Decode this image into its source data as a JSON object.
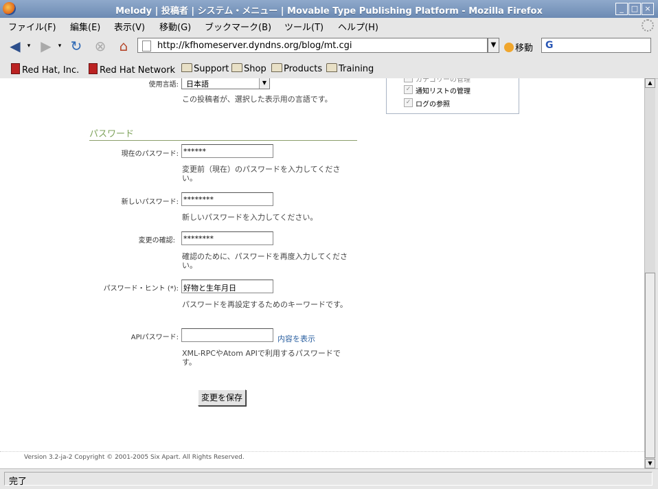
{
  "window": {
    "title": "Melody | 投稿者 | システム・メニュー | Movable Type Publishing Platform - Mozilla Firefox",
    "buttons": [
      "_",
      "□",
      "×"
    ]
  },
  "menu": {
    "items": [
      "ファイル(F)",
      "編集(E)",
      "表示(V)",
      "移動(G)",
      "ブックマーク(B)",
      "ツール(T)",
      "ヘルプ(H)"
    ]
  },
  "nav": {
    "url": "http://kfhomeserver.dyndns.org/blog/mt.cgi",
    "go_label": "移動",
    "search_placeholder": ""
  },
  "bookmarks": [
    "Red Hat, Inc.",
    "Red Hat Network",
    "Support",
    "Shop",
    "Products",
    "Training"
  ],
  "language": {
    "label": "使用言語:",
    "value": "日本語",
    "help": "この投稿者が、選択した表示用の言語です。"
  },
  "permissions": [
    "カテゴリーの管理",
    "通知リストの管理",
    "ログの参照"
  ],
  "password_section": {
    "title": "パスワード",
    "current": {
      "label": "現在のパスワード:",
      "value": "******",
      "help": "変更前（現在）のパスワードを入力してください。"
    },
    "new": {
      "label": "新しいパスワード:",
      "value": "********",
      "help": "新しいパスワードを入力してください。"
    },
    "confirm": {
      "label": "変更の確認:",
      "value": "********",
      "help": "確認のために、パスワードを再度入力してください。"
    },
    "hint": {
      "label": "パスワード・ヒント (*):",
      "value": "好物と生年月日",
      "help": "パスワードを再設定するためのキーワードです。"
    },
    "api": {
      "label": "APIパスワード:",
      "value": "",
      "show_link": "内容を表示",
      "help": "XML-RPCやAtom APIで利用するパスワードです。"
    }
  },
  "save_button": "変更を保存",
  "footer": "Version 3.2-ja-2 Copyright © 2001-2005 Six Apart. All Rights Reserved.",
  "status": "完了"
}
